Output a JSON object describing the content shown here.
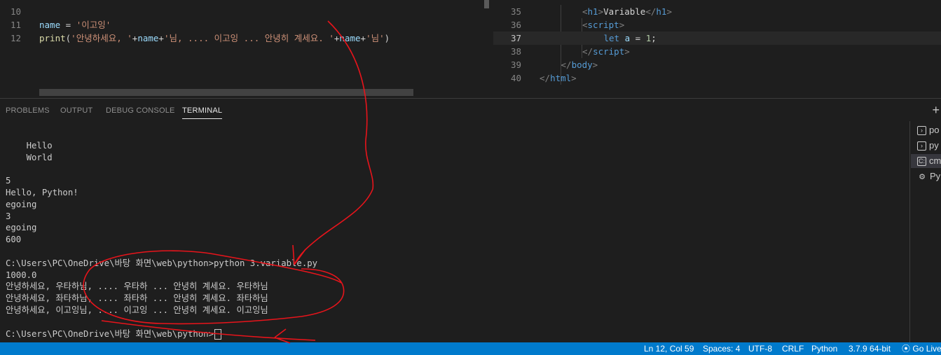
{
  "editor_left": {
    "lines": [
      {
        "num": "10",
        "tokens": []
      },
      {
        "num": "11",
        "tokens": [
          {
            "t": "name",
            "c": "k-var"
          },
          {
            "t": " = ",
            "c": "k-txt"
          },
          {
            "t": "'이고잉'",
            "c": "k-str"
          }
        ]
      },
      {
        "num": "12",
        "tokens": [
          {
            "t": "print",
            "c": "k-fn"
          },
          {
            "t": "(",
            "c": "k-txt"
          },
          {
            "t": "'안녕하세요, '",
            "c": "k-str"
          },
          {
            "t": "+",
            "c": "k-txt"
          },
          {
            "t": "name",
            "c": "k-var"
          },
          {
            "t": "+",
            "c": "k-txt"
          },
          {
            "t": "'님, .... 이고잉 ... 안녕히 계세요. '",
            "c": "k-str"
          },
          {
            "t": "+",
            "c": "k-txt"
          },
          {
            "t": "name",
            "c": "k-var"
          },
          {
            "t": "+",
            "c": "k-txt"
          },
          {
            "t": "'님'",
            "c": "k-str"
          },
          {
            "t": ")",
            "c": "k-txt"
          }
        ]
      }
    ]
  },
  "editor_right": {
    "lines": [
      {
        "num": "35",
        "indent": 2,
        "tokens": [
          {
            "t": "<",
            "c": "k-brk"
          },
          {
            "t": "h1",
            "c": "k-tag"
          },
          {
            "t": ">",
            "c": "k-brk"
          },
          {
            "t": "Variable",
            "c": "k-txt"
          },
          {
            "t": "</",
            "c": "k-brk"
          },
          {
            "t": "h1",
            "c": "k-tag"
          },
          {
            "t": ">",
            "c": "k-brk"
          }
        ]
      },
      {
        "num": "36",
        "indent": 2,
        "tokens": [
          {
            "t": "<",
            "c": "k-brk"
          },
          {
            "t": "script",
            "c": "k-tag"
          },
          {
            "t": ">",
            "c": "k-brk"
          }
        ]
      },
      {
        "num": "37",
        "indent": 3,
        "active": true,
        "tokens": [
          {
            "t": "let",
            "c": "k-tag"
          },
          {
            "t": " ",
            "c": "k-txt"
          },
          {
            "t": "a",
            "c": "k-var"
          },
          {
            "t": " = ",
            "c": "k-txt"
          },
          {
            "t": "1",
            "c": "k-num"
          },
          {
            "t": ";",
            "c": "k-txt"
          }
        ]
      },
      {
        "num": "38",
        "indent": 2,
        "tokens": [
          {
            "t": "</",
            "c": "k-brk"
          },
          {
            "t": "script",
            "c": "k-tag"
          },
          {
            "t": ">",
            "c": "k-brk"
          }
        ]
      },
      {
        "num": "39",
        "indent": 1,
        "tokens": [
          {
            "t": "</",
            "c": "k-brk"
          },
          {
            "t": "body",
            "c": "k-tag"
          },
          {
            "t": ">",
            "c": "k-brk"
          }
        ]
      },
      {
        "num": "40",
        "indent": 0,
        "tokens": [
          {
            "t": "</",
            "c": "k-brk"
          },
          {
            "t": "html",
            "c": "k-tag"
          },
          {
            "t": ">",
            "c": "k-brk"
          }
        ]
      }
    ]
  },
  "panel": {
    "tabs": [
      "PROBLEMS",
      "OUTPUT",
      "DEBUG CONSOLE",
      "TERMINAL"
    ],
    "active_tab": "TERMINAL",
    "add_label": "+"
  },
  "terminal": {
    "lines": [
      "",
      "    Hello",
      "    World",
      "",
      "5",
      "Hello, Python!",
      "egoing",
      "3",
      "egoing",
      "600",
      "",
      "C:\\Users\\PC\\OneDrive\\바탕 화면\\web\\python>python 3.variable.py",
      "1000.0",
      "안녕하세요, 우타하님, .... 우타하 ... 안녕히 계세요. 우타하님",
      "안녕하세요, 좌타하님, .... 좌타하 ... 안녕히 계세요. 좌타하님",
      "안녕하세요, 이고잉님, .... 이고잉 ... 안녕히 계세요. 이고잉님",
      ""
    ],
    "prompt": "C:\\Users\\PC\\OneDrive\\바탕 화면\\web\\python>"
  },
  "terminal_list": [
    {
      "icon": "terminal-icon",
      "label": "po"
    },
    {
      "icon": "terminal-icon",
      "label": "py"
    },
    {
      "icon": "cmd-icon",
      "label": "cm",
      "selected": true
    },
    {
      "icon": "debug-gear-icon",
      "label": "Py"
    }
  ],
  "status": {
    "position": "Ln 12, Col 59",
    "spaces": "Spaces: 4",
    "encoding": "UTF-8",
    "eol": "CRLF",
    "language": "Python",
    "interpreter": "3.7.9 64-bit",
    "go_live": "Go Live"
  },
  "colors": {
    "statusbar": "#007acc",
    "annotation": "#e8141b"
  }
}
